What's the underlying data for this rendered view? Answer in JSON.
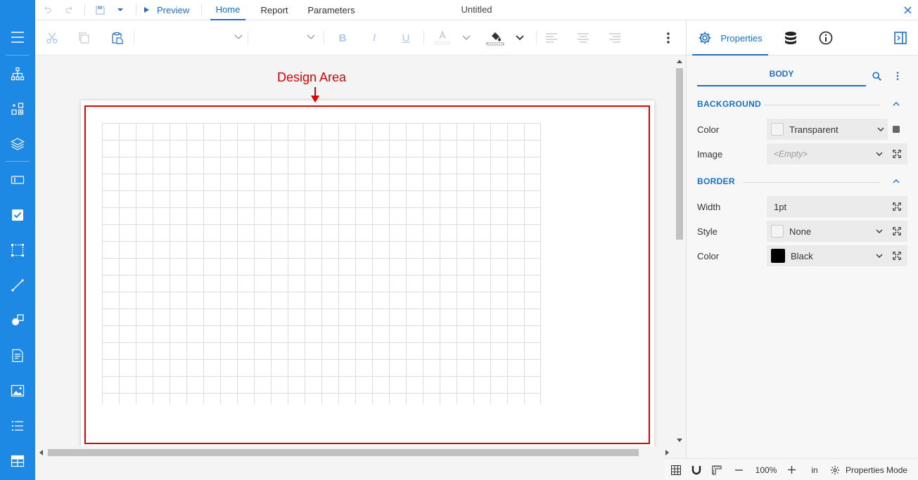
{
  "topbar": {
    "preview_label": "Preview",
    "tabs": [
      {
        "label": "Home",
        "active": true
      },
      {
        "label": "Report",
        "active": false
      },
      {
        "label": "Parameters",
        "active": false
      }
    ],
    "document_title": "Untitled"
  },
  "toolbar": {
    "font_family_value": "",
    "font_size_value": ""
  },
  "design": {
    "annotation_label": "Design Area",
    "annotation_color": "#e00000"
  },
  "properties_panel": {
    "tabs": [
      {
        "label": "Properties",
        "icon": "gear-icon",
        "active": true
      },
      {
        "label": "",
        "icon": "database-icon",
        "active": false
      },
      {
        "label": "",
        "icon": "info-icon",
        "active": false
      }
    ],
    "element_name": "BODY",
    "sections": {
      "background": {
        "title": "BACKGROUND",
        "color_label": "Color",
        "color_value": "Transparent",
        "image_label": "Image",
        "image_value": "<Empty>"
      },
      "border": {
        "title": "BORDER",
        "width_label": "Width",
        "width_value": "1pt",
        "style_label": "Style",
        "style_value": "None",
        "color_label": "Color",
        "color_value": "Black",
        "color_swatch": "#000000"
      }
    }
  },
  "statusbar": {
    "zoom_value": "100%",
    "unit_value": "in",
    "properties_mode_label": "Properties Mode"
  },
  "colors": {
    "accent": "#1e6fc7",
    "sidebar": "#1e88e5"
  }
}
